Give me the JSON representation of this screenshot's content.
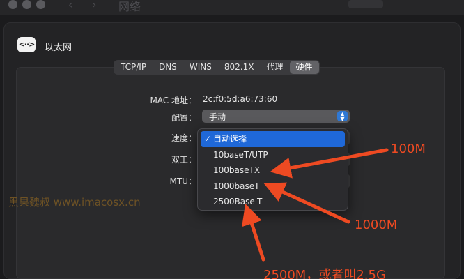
{
  "window": {
    "title": "网络"
  },
  "interface": {
    "icon": "ethernet-icon",
    "icon_glyph": "<··>",
    "name": "以太网"
  },
  "tabs": [
    {
      "label": "TCP/IP",
      "active": false
    },
    {
      "label": "DNS",
      "active": false
    },
    {
      "label": "WINS",
      "active": false
    },
    {
      "label": "802.1X",
      "active": false
    },
    {
      "label": "代理",
      "active": false
    },
    {
      "label": "硬件",
      "active": true
    }
  ],
  "form": {
    "mac_label": "MAC 地址：",
    "mac_value": "2c:f0:5d:a6:73:60",
    "config_label": "配置：",
    "config_value": "手动",
    "speed_label": "速度：",
    "duplex_label": "双工：",
    "mtu_label": "MTU："
  },
  "speed_menu": {
    "options": [
      {
        "label": "自动选择",
        "selected": true
      },
      {
        "label": "10baseT/UTP",
        "selected": false
      },
      {
        "label": "100baseTX",
        "selected": false
      },
      {
        "label": "1000baseT",
        "selected": false
      },
      {
        "label": "2500Base-T",
        "selected": false
      }
    ]
  },
  "annotations": {
    "a100": "100M",
    "a1000": "1000M",
    "a2500": "2500M，或者叫2.5G",
    "color": "#ee4a22"
  },
  "watermark": "黑果魏叔 www.imacosx.cn",
  "colors": {
    "accent": "#1f68d8",
    "background": "#1b1b1d"
  }
}
